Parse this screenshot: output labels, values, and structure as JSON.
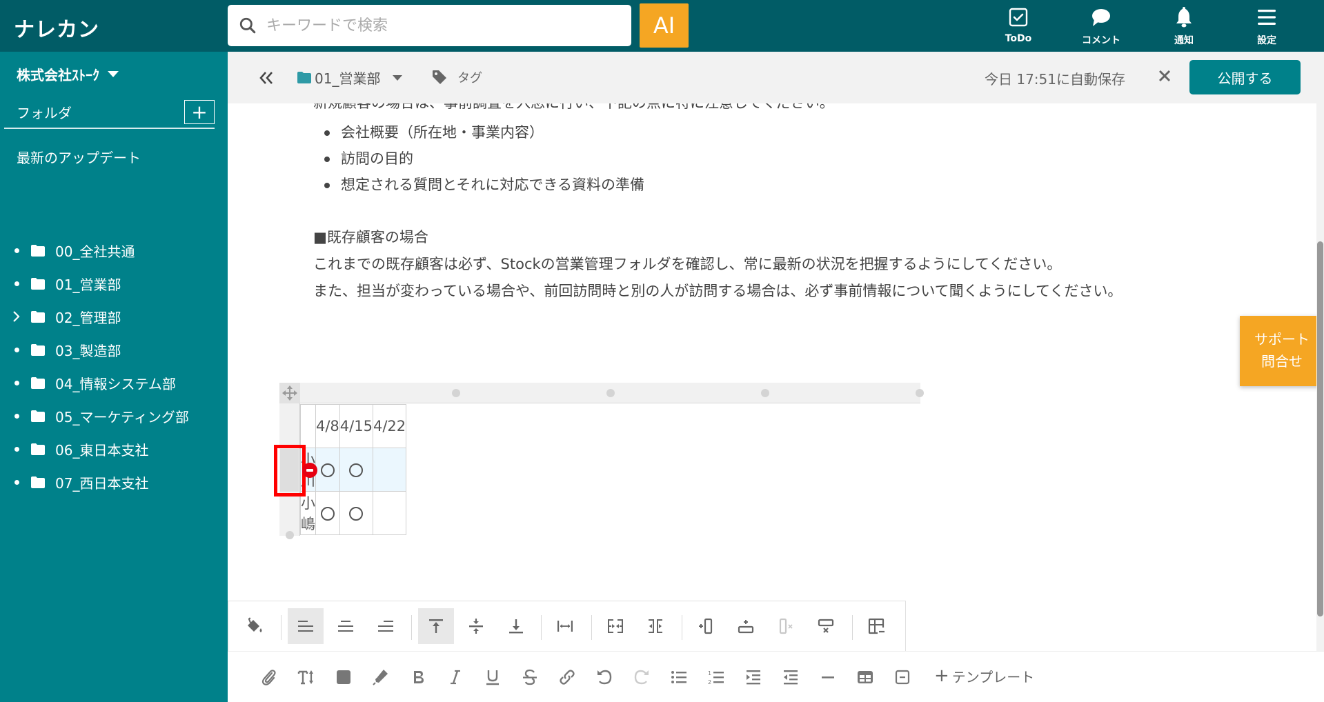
{
  "app": {
    "brand": "ナレカン",
    "search_placeholder": "キーワードで検索",
    "ai_label": "AI",
    "top_nav": [
      {
        "id": "todo",
        "label": "ToDo",
        "icon": "checkbox-icon"
      },
      {
        "id": "comment",
        "label": "コメント",
        "icon": "speech-bubble-icon"
      },
      {
        "id": "notification",
        "label": "通知",
        "icon": "bell-icon"
      },
      {
        "id": "settings",
        "label": "設定",
        "icon": "hamburger-menu-icon"
      }
    ]
  },
  "sidebar": {
    "company": "株式会社ｽﾄｰｸ",
    "folder_heading": "フォルダ",
    "add_folder_label": "+",
    "recent_updates": "最新のアップデート",
    "folders": [
      {
        "name": "00_全社共通",
        "expandable": false
      },
      {
        "name": "01_営業部",
        "expandable": false
      },
      {
        "name": "02_管理部",
        "expandable": true
      },
      {
        "name": "03_製造部",
        "expandable": false
      },
      {
        "name": "04_情報システム部",
        "expandable": false
      },
      {
        "name": "05_マーケティング部",
        "expandable": false
      },
      {
        "name": "06_東日本支社",
        "expandable": false
      },
      {
        "name": "07_西日本支社",
        "expandable": false
      }
    ]
  },
  "editor_header": {
    "folder": "01_営業部",
    "tag_label": "タグ",
    "autosave": "今日 17:51に自動保存",
    "publish_label": "公開する"
  },
  "document": {
    "clipped_line": "新規顧客の場合は、事前調査を入念に行い、下記の点に特に注意してください。",
    "bullets": [
      "会社概要（所在地・事業内容）",
      "訪問の目的",
      "想定される質問とそれに対応できる資料の準備"
    ],
    "section_heading": "■既存顧客の場合",
    "paragraph1": "これまでの既存顧客は必ず、Stockの営業管理フォルダを確認し、常に最新の状況を把握するようにしてください。",
    "paragraph2": "また、担当が変わっている場合や、前回訪問時と別の人が訪問する場合は、必ず事前情報について聞くようにしてください。",
    "table": {
      "header": [
        "",
        "4/8",
        "4/15",
        "4/22"
      ],
      "rows": [
        {
          "cells": [
            "小川",
            "○",
            "○",
            ""
          ],
          "selected": true
        },
        {
          "cells": [
            "小嶋",
            "○",
            "○",
            ""
          ],
          "selected": false
        }
      ]
    }
  },
  "table_toolbar": [
    {
      "name": "cell-fill-color-button",
      "icon": "paint-bucket-icon",
      "active": false,
      "disabled": false
    },
    {
      "name": "align-left-button",
      "icon": "align-left-icon",
      "active": true,
      "disabled": false
    },
    {
      "name": "align-center-button",
      "icon": "align-center-icon",
      "active": false,
      "disabled": false
    },
    {
      "name": "align-right-button",
      "icon": "align-right-icon",
      "active": false,
      "disabled": false
    },
    {
      "name": "valign-top-button",
      "icon": "valign-top-icon",
      "active": true,
      "disabled": false
    },
    {
      "name": "valign-middle-button",
      "icon": "valign-middle-icon",
      "active": false,
      "disabled": false
    },
    {
      "name": "valign-bottom-button",
      "icon": "valign-bottom-icon",
      "active": false,
      "disabled": false
    },
    {
      "name": "column-width-button",
      "icon": "column-width-icon",
      "active": false,
      "disabled": false
    },
    {
      "name": "merge-cells-button",
      "icon": "merge-cells-icon",
      "active": false,
      "disabled": false
    },
    {
      "name": "split-cells-button",
      "icon": "split-cells-icon",
      "active": false,
      "disabled": false
    },
    {
      "name": "insert-column-button",
      "icon": "insert-column-icon",
      "active": false,
      "disabled": false
    },
    {
      "name": "insert-row-button",
      "icon": "insert-row-icon",
      "active": false,
      "disabled": false
    },
    {
      "name": "delete-column-button",
      "icon": "delete-column-icon",
      "active": false,
      "disabled": true
    },
    {
      "name": "delete-row-button",
      "icon": "delete-row-icon",
      "active": false,
      "disabled": false
    },
    {
      "name": "delete-table-button",
      "icon": "delete-table-icon",
      "active": false,
      "disabled": false
    }
  ],
  "bottom_toolbar": {
    "template_label": "テンプレート",
    "buttons": [
      {
        "name": "attach-button",
        "icon": "paperclip-icon"
      },
      {
        "name": "font-size-button",
        "icon": "text-size-icon"
      },
      {
        "name": "text-color-button",
        "icon": "color-square-icon"
      },
      {
        "name": "highlight-button",
        "icon": "highlighter-icon"
      },
      {
        "name": "bold-button",
        "icon": "bold-icon"
      },
      {
        "name": "italic-button",
        "icon": "italic-icon"
      },
      {
        "name": "underline-button",
        "icon": "underline-icon"
      },
      {
        "name": "strikethrough-button",
        "icon": "strikethrough-icon"
      },
      {
        "name": "link-button",
        "icon": "link-icon"
      },
      {
        "name": "undo-button",
        "icon": "undo-icon"
      },
      {
        "name": "redo-button",
        "icon": "redo-icon",
        "disabled": true
      },
      {
        "name": "bullet-list-button",
        "icon": "bullet-list-icon"
      },
      {
        "name": "numbered-list-button",
        "icon": "numbered-list-icon"
      },
      {
        "name": "indent-button",
        "icon": "indent-icon"
      },
      {
        "name": "outdent-button",
        "icon": "outdent-icon"
      },
      {
        "name": "horizontal-rule-button",
        "icon": "horizontal-rule-icon"
      },
      {
        "name": "insert-table-button",
        "icon": "table-icon"
      },
      {
        "name": "collapse-block-button",
        "icon": "collapse-box-icon"
      }
    ]
  },
  "support": {
    "line1": "サポート",
    "line2": "問合せ"
  },
  "colors": {
    "topbar": "#015c66",
    "sidebar": "#00818a",
    "accent_orange": "#f5a623",
    "publish_button": "#00818a",
    "selected_row": "#ebf7fe",
    "highlight_box": "#ff0000"
  }
}
